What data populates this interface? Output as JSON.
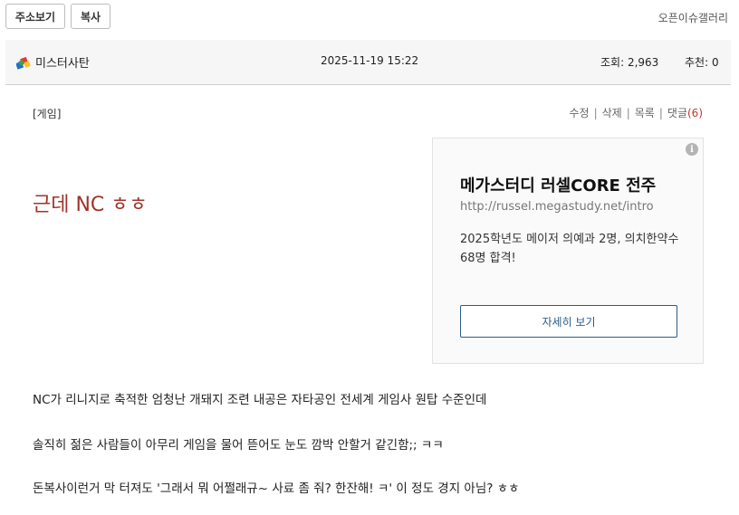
{
  "toolbar": {
    "address_button": "주소보기",
    "copy_button": "복사",
    "gallery_link": "오픈이슈갤러리"
  },
  "post_info": {
    "author": "미스터사탄",
    "author_icon": "colorful-flag-icon",
    "datetime": "2025-11-19 15:22",
    "views": "조회: 2,963",
    "recommendations": "추천: 0"
  },
  "post": {
    "category": "[게임]",
    "actions": {
      "edit": "수정",
      "delete": "삭제",
      "list": "목록",
      "comments": "댓글",
      "comment_count": "(6)",
      "separator": "|"
    },
    "title": "근데 NC ㅎㅎ",
    "paragraphs": [
      "NC가 리니지로 축적한 엄청난 개돼지 조련 내공은 자타공인 전세계 게임사 원탑 수준인데",
      "솔직히 젊은 사람들이 아무리 게임을 물어 뜯어도 눈도 깜박 안할거 같긴함;; ㅋㅋ",
      "돈복사이런거 막 터져도 '그래서 뭐 어쩔래규~ 사료 좀 줘? 한잔해! ㅋ' 이 정도 경지 아님? ㅎㅎ"
    ]
  },
  "ad": {
    "info_icon": "i",
    "title": "메가스터디 러셀CORE 전주",
    "url": "http://russel.megastudy.net/intro",
    "description": "2025학년도 메이저 의예과 2명, 의치한약수 68명 합격!",
    "cta": "자세히 보기"
  },
  "colors": {
    "title": "#a0332a",
    "comment_count": "#c0392b",
    "ad_cta": "#2b5d86",
    "infobar_bg": "#f6f6f6"
  }
}
